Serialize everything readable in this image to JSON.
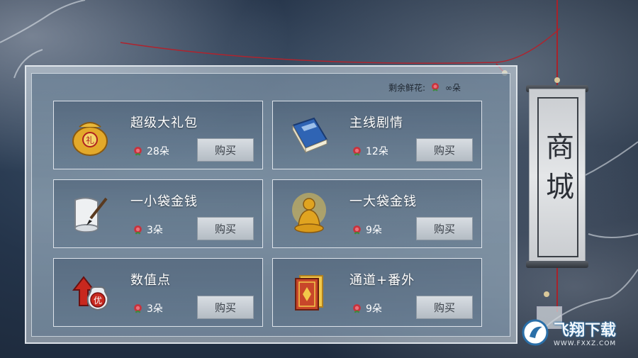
{
  "screen": {
    "title": "商城",
    "remaining_label": "剩余鲜花:",
    "remaining_value": "∞朵",
    "buy_label": "购买"
  },
  "items": [
    {
      "name": "超级大礼包",
      "price": "28朵",
      "icon": "gift-bag-icon"
    },
    {
      "name": "主线剧情",
      "price": "12朵",
      "icon": "book-icon"
    },
    {
      "name": "一小袋金钱",
      "price": "3朵",
      "icon": "scroll-brush-icon"
    },
    {
      "name": "一大袋金钱",
      "price": "9朵",
      "icon": "golden-buddha-icon"
    },
    {
      "name": "数值点",
      "price": "3朵",
      "icon": "stat-up-potion-icon"
    },
    {
      "name": "通道+番外",
      "price": "9朵",
      "icon": "red-card-icon"
    }
  ],
  "watermark": {
    "text": "飞翔下载",
    "url": "WWW.FXXZ.COM"
  },
  "colors": {
    "rose": "#c8323c",
    "card_border": "#e6ecf2",
    "button_bg": "#c4cbd2"
  }
}
